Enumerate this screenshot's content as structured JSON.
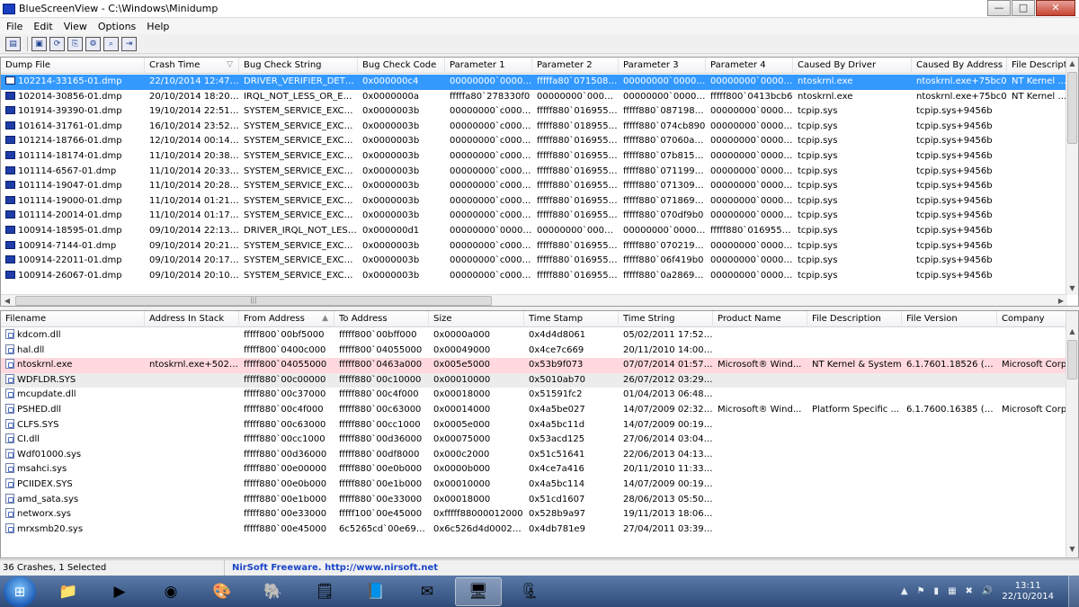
{
  "window": {
    "title": "BlueScreenView - C:\\Windows\\Minidump",
    "buttons": {
      "minimize": "—",
      "maximize": "□",
      "close": "✕"
    }
  },
  "menu": [
    "File",
    "Edit",
    "View",
    "Options",
    "Help"
  ],
  "toolbar_icons": [
    "properties-icon",
    "save-icon",
    "refresh-icon",
    "copy-icon",
    "options-icon",
    "search-icon",
    "exit-icon"
  ],
  "dumps": {
    "columns": [
      {
        "label": "Dump File"
      },
      {
        "label": "Crash Time",
        "sort": "▽"
      },
      {
        "label": "Bug Check String"
      },
      {
        "label": "Bug Check Code"
      },
      {
        "label": "Parameter 1"
      },
      {
        "label": "Parameter 2"
      },
      {
        "label": "Parameter 3"
      },
      {
        "label": "Parameter 4"
      },
      {
        "label": "Caused By Driver"
      },
      {
        "label": "Caused By Address"
      },
      {
        "label": "File Descriptio"
      }
    ],
    "rows": [
      {
        "selected": true,
        "cells": [
          "102214-33165-01.dmp",
          "22/10/2014 12:47:00",
          "DRIVER_VERIFIER_DETEC...",
          "0x000000c4",
          "00000000`000000...",
          "fffffa80`071508d0",
          "00000000`000000...",
          "00000000`000000...",
          "ntoskrnl.exe",
          "ntoskrnl.exe+75bc0",
          "NT Kernel & S"
        ]
      },
      {
        "cells": [
          "102014-30856-01.dmp",
          "20/10/2014 18:20:17",
          "IRQL_NOT_LESS_OR_EQ...",
          "0x0000000a",
          "fffffa80`278330f0",
          "00000000`000000...",
          "00000000`000000...",
          "fffff800`0413bcb6",
          "ntoskrnl.exe",
          "ntoskrnl.exe+75bc0",
          "NT Kernel & S"
        ]
      },
      {
        "cells": [
          "101914-39390-01.dmp",
          "19/10/2014 22:51:30",
          "SYSTEM_SERVICE_EXCE...",
          "0x0000003b",
          "00000000`c00000...",
          "fffff880`0169556b",
          "fffff880`08719890",
          "00000000`000000...",
          "tcpip.sys",
          "tcpip.sys+9456b",
          ""
        ]
      },
      {
        "cells": [
          "101614-31761-01.dmp",
          "16/10/2014 23:52:54",
          "SYSTEM_SERVICE_EXCE...",
          "0x0000003b",
          "00000000`c00000...",
          "fffff880`0189556b",
          "fffff880`074cb890",
          "00000000`000000...",
          "tcpip.sys",
          "tcpip.sys+9456b",
          ""
        ]
      },
      {
        "cells": [
          "101214-18766-01.dmp",
          "12/10/2014 00:14:12",
          "SYSTEM_SERVICE_EXCE...",
          "0x0000003b",
          "00000000`c00000...",
          "fffff880`0169556b",
          "fffff880`07060a40",
          "00000000`000000...",
          "tcpip.sys",
          "tcpip.sys+9456b",
          ""
        ]
      },
      {
        "cells": [
          "101114-18174-01.dmp",
          "11/10/2014 20:38:36",
          "SYSTEM_SERVICE_EXCE...",
          "0x0000003b",
          "00000000`c00000...",
          "fffff880`0169556b",
          "fffff880`07b81530",
          "00000000`000000...",
          "tcpip.sys",
          "tcpip.sys+9456b",
          ""
        ]
      },
      {
        "cells": [
          "101114-6567-01.dmp",
          "11/10/2014 20:33:57",
          "SYSTEM_SERVICE_EXCE...",
          "0x0000003b",
          "00000000`c00000...",
          "fffff880`0169556b",
          "fffff880`071199b0",
          "00000000`000000...",
          "tcpip.sys",
          "tcpip.sys+9456b",
          ""
        ]
      },
      {
        "cells": [
          "101114-19047-01.dmp",
          "11/10/2014 20:28:49",
          "SYSTEM_SERVICE_EXCE...",
          "0x0000003b",
          "00000000`c00000...",
          "fffff880`0169556b",
          "fffff880`071309b0",
          "00000000`000000...",
          "tcpip.sys",
          "tcpip.sys+9456b",
          ""
        ]
      },
      {
        "cells": [
          "101114-19000-01.dmp",
          "11/10/2014 01:21:07",
          "SYSTEM_SERVICE_EXCE...",
          "0x0000003b",
          "00000000`c00000...",
          "fffff880`0169556b",
          "fffff880`071869b0",
          "00000000`000000...",
          "tcpip.sys",
          "tcpip.sys+9456b",
          ""
        ]
      },
      {
        "cells": [
          "101114-20014-01.dmp",
          "11/10/2014 01:17:50",
          "SYSTEM_SERVICE_EXCE...",
          "0x0000003b",
          "00000000`c00000...",
          "fffff880`0169556b",
          "fffff880`070df9b0",
          "00000000`000000...",
          "tcpip.sys",
          "tcpip.sys+9456b",
          ""
        ]
      },
      {
        "cells": [
          "100914-18595-01.dmp",
          "09/10/2014 22:13:05",
          "DRIVER_IRQL_NOT_LESS...",
          "0x000000d1",
          "00000000`000000...",
          "00000000`000000...",
          "00000000`000000...",
          "fffff880`0169556b",
          "tcpip.sys",
          "tcpip.sys+9456b",
          ""
        ]
      },
      {
        "cells": [
          "100914-7144-01.dmp",
          "09/10/2014 20:21:10",
          "SYSTEM_SERVICE_EXCE...",
          "0x0000003b",
          "00000000`c00000...",
          "fffff880`0169556b",
          "fffff880`070219b0",
          "00000000`000000...",
          "tcpip.sys",
          "tcpip.sys+9456b",
          ""
        ]
      },
      {
        "cells": [
          "100914-22011-01.dmp",
          "09/10/2014 20:17:44",
          "SYSTEM_SERVICE_EXCE...",
          "0x0000003b",
          "00000000`c00000...",
          "fffff880`0169556b",
          "fffff880`06f419b0",
          "00000000`000000...",
          "tcpip.sys",
          "tcpip.sys+9456b",
          ""
        ]
      },
      {
        "cells": [
          "100914-26067-01.dmp",
          "09/10/2014 20:10:55",
          "SYSTEM_SERVICE_EXCE...",
          "0x0000003b",
          "00000000`c00000...",
          "fffff880`0169556b",
          "fffff880`0a2869b0",
          "00000000`000000...",
          "tcpip.sys",
          "tcpip.sys+9456b",
          ""
        ]
      }
    ]
  },
  "modules": {
    "columns": [
      {
        "label": "Filename"
      },
      {
        "label": "Address In Stack"
      },
      {
        "label": "From Address",
        "sort": "▲"
      },
      {
        "label": "To Address"
      },
      {
        "label": "Size"
      },
      {
        "label": "Time Stamp"
      },
      {
        "label": "Time String"
      },
      {
        "label": "Product Name"
      },
      {
        "label": "File Description"
      },
      {
        "label": "File Version"
      },
      {
        "label": "Company"
      }
    ],
    "rows": [
      {
        "cells": [
          "kdcom.dll",
          "",
          "fffff800`00bf5000",
          "fffff800`00bff000",
          "0x0000a000",
          "0x4d4d8061",
          "05/02/2011 17:52:49",
          "",
          "",
          "",
          ""
        ]
      },
      {
        "cells": [
          "hal.dll",
          "",
          "fffff800`0400c000",
          "fffff800`04055000",
          "0x00049000",
          "0x4ce7c669",
          "20/11/2010 14:00:25",
          "",
          "",
          "",
          ""
        ]
      },
      {
        "highlight": "pink",
        "cells": [
          "ntoskrnl.exe",
          "ntoskrnl.exe+5024ec",
          "fffff800`04055000",
          "fffff800`0463a000",
          "0x005e5000",
          "0x53b9f073",
          "07/07/2014 01:57:23",
          "Microsoft® Wind...",
          "NT Kernel & System",
          "6.1.7601.18526 (wi...",
          "Microsoft Corp"
        ]
      },
      {
        "highlight": "gray",
        "cells": [
          "WDFLDR.SYS",
          "",
          "fffff880`00c00000",
          "fffff880`00c10000",
          "0x00010000",
          "0x5010ab70",
          "26/07/2012 03:29:04",
          "",
          "",
          "",
          ""
        ]
      },
      {
        "cells": [
          "mcupdate.dll",
          "",
          "fffff880`00c37000",
          "fffff880`00c4f000",
          "0x00018000",
          "0x51591fc2",
          "01/04/2013 06:48:50",
          "",
          "",
          "",
          ""
        ]
      },
      {
        "cells": [
          "PSHED.dll",
          "",
          "fffff880`00c4f000",
          "fffff880`00c63000",
          "0x00014000",
          "0x4a5be027",
          "14/07/2009 02:32:39",
          "Microsoft® Wind...",
          "Platform Specific ...",
          "6.1.7600.16385 (wi...",
          "Microsoft Corp"
        ]
      },
      {
        "cells": [
          "CLFS.SYS",
          "",
          "fffff880`00c63000",
          "fffff880`00cc1000",
          "0x0005e000",
          "0x4a5bc11d",
          "14/07/2009 00:19:57",
          "",
          "",
          "",
          ""
        ]
      },
      {
        "cells": [
          "CI.dll",
          "",
          "fffff880`00cc1000",
          "fffff880`00d36000",
          "0x00075000",
          "0x53acd125",
          "27/06/2014 03:04:21",
          "",
          "",
          "",
          ""
        ]
      },
      {
        "cells": [
          "Wdf01000.sys",
          "",
          "fffff880`00d36000",
          "fffff880`00df8000",
          "0x000c2000",
          "0x51c51641",
          "22/06/2013 04:13:05",
          "",
          "",
          "",
          ""
        ]
      },
      {
        "cells": [
          "msahci.sys",
          "",
          "fffff880`00e00000",
          "fffff880`00e0b000",
          "0x0000b000",
          "0x4ce7a416",
          "20/11/2010 11:33:58",
          "",
          "",
          "",
          ""
        ]
      },
      {
        "cells": [
          "PCIIDEX.SYS",
          "",
          "fffff880`00e0b000",
          "fffff880`00e1b000",
          "0x00010000",
          "0x4a5bc114",
          "14/07/2009 00:19:48",
          "",
          "",
          "",
          ""
        ]
      },
      {
        "cells": [
          "amd_sata.sys",
          "",
          "fffff880`00e1b000",
          "fffff880`00e33000",
          "0x00018000",
          "0x51cd1607",
          "28/06/2013 05:50:15",
          "",
          "",
          "",
          ""
        ]
      },
      {
        "cells": [
          "networx.sys",
          "",
          "fffff880`00e33000",
          "fffff100`00e45000",
          "0xfffff88000012000",
          "0x528b9a97",
          "19/11/2013 18:06:31",
          "",
          "",
          "",
          ""
        ]
      },
      {
        "cells": [
          "mrxsmb20.sys",
          "",
          "fffff880`00e45000",
          "6c5265cd`00e69000",
          "0x6c526d4d000240...",
          "0x4db781e9",
          "27/04/2011 03:39:37",
          "",
          "",
          "",
          ""
        ]
      }
    ]
  },
  "status": {
    "count": "36 Crashes, 1 Selected",
    "link": "NirSoft Freeware.  http://www.nirsoft.net"
  },
  "taskbar": {
    "apps": [
      {
        "name": "explorer",
        "glyph": "📁"
      },
      {
        "name": "media-player",
        "glyph": "▶"
      },
      {
        "name": "chrome",
        "glyph": "◉"
      },
      {
        "name": "paint",
        "glyph": "🎨"
      },
      {
        "name": "evernote",
        "glyph": "🐘"
      },
      {
        "name": "sticky-notes",
        "glyph": "🗒"
      },
      {
        "name": "notes",
        "glyph": "📘"
      },
      {
        "name": "mail",
        "glyph": "✉"
      },
      {
        "name": "bluescreenview",
        "glyph": "🖥",
        "active": true
      },
      {
        "name": "archiver",
        "glyph": "🗜"
      }
    ],
    "tray_icons": [
      "▲",
      "⚑",
      "▮",
      "▦",
      "✖",
      "🔊"
    ],
    "time": "13:11",
    "date": "22/10/2014"
  }
}
